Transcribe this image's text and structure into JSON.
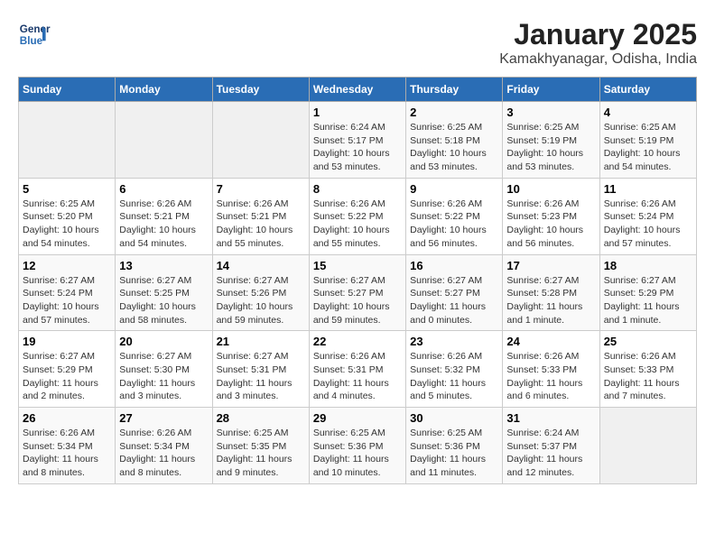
{
  "logo": {
    "text_line1": "General",
    "text_line2": "Blue"
  },
  "title": "January 2025",
  "subtitle": "Kamakhyanagar, Odisha, India",
  "days_of_week": [
    "Sunday",
    "Monday",
    "Tuesday",
    "Wednesday",
    "Thursday",
    "Friday",
    "Saturday"
  ],
  "weeks": [
    [
      {
        "day": "",
        "sunrise": "",
        "sunset": "",
        "daylight": ""
      },
      {
        "day": "",
        "sunrise": "",
        "sunset": "",
        "daylight": ""
      },
      {
        "day": "",
        "sunrise": "",
        "sunset": "",
        "daylight": ""
      },
      {
        "day": "1",
        "sunrise": "Sunrise: 6:24 AM",
        "sunset": "Sunset: 5:17 PM",
        "daylight": "Daylight: 10 hours and 53 minutes."
      },
      {
        "day": "2",
        "sunrise": "Sunrise: 6:25 AM",
        "sunset": "Sunset: 5:18 PM",
        "daylight": "Daylight: 10 hours and 53 minutes."
      },
      {
        "day": "3",
        "sunrise": "Sunrise: 6:25 AM",
        "sunset": "Sunset: 5:19 PM",
        "daylight": "Daylight: 10 hours and 53 minutes."
      },
      {
        "day": "4",
        "sunrise": "Sunrise: 6:25 AM",
        "sunset": "Sunset: 5:19 PM",
        "daylight": "Daylight: 10 hours and 54 minutes."
      }
    ],
    [
      {
        "day": "5",
        "sunrise": "Sunrise: 6:25 AM",
        "sunset": "Sunset: 5:20 PM",
        "daylight": "Daylight: 10 hours and 54 minutes."
      },
      {
        "day": "6",
        "sunrise": "Sunrise: 6:26 AM",
        "sunset": "Sunset: 5:21 PM",
        "daylight": "Daylight: 10 hours and 54 minutes."
      },
      {
        "day": "7",
        "sunrise": "Sunrise: 6:26 AM",
        "sunset": "Sunset: 5:21 PM",
        "daylight": "Daylight: 10 hours and 55 minutes."
      },
      {
        "day": "8",
        "sunrise": "Sunrise: 6:26 AM",
        "sunset": "Sunset: 5:22 PM",
        "daylight": "Daylight: 10 hours and 55 minutes."
      },
      {
        "day": "9",
        "sunrise": "Sunrise: 6:26 AM",
        "sunset": "Sunset: 5:22 PM",
        "daylight": "Daylight: 10 hours and 56 minutes."
      },
      {
        "day": "10",
        "sunrise": "Sunrise: 6:26 AM",
        "sunset": "Sunset: 5:23 PM",
        "daylight": "Daylight: 10 hours and 56 minutes."
      },
      {
        "day": "11",
        "sunrise": "Sunrise: 6:26 AM",
        "sunset": "Sunset: 5:24 PM",
        "daylight": "Daylight: 10 hours and 57 minutes."
      }
    ],
    [
      {
        "day": "12",
        "sunrise": "Sunrise: 6:27 AM",
        "sunset": "Sunset: 5:24 PM",
        "daylight": "Daylight: 10 hours and 57 minutes."
      },
      {
        "day": "13",
        "sunrise": "Sunrise: 6:27 AM",
        "sunset": "Sunset: 5:25 PM",
        "daylight": "Daylight: 10 hours and 58 minutes."
      },
      {
        "day": "14",
        "sunrise": "Sunrise: 6:27 AM",
        "sunset": "Sunset: 5:26 PM",
        "daylight": "Daylight: 10 hours and 59 minutes."
      },
      {
        "day": "15",
        "sunrise": "Sunrise: 6:27 AM",
        "sunset": "Sunset: 5:27 PM",
        "daylight": "Daylight: 10 hours and 59 minutes."
      },
      {
        "day": "16",
        "sunrise": "Sunrise: 6:27 AM",
        "sunset": "Sunset: 5:27 PM",
        "daylight": "Daylight: 11 hours and 0 minutes."
      },
      {
        "day": "17",
        "sunrise": "Sunrise: 6:27 AM",
        "sunset": "Sunset: 5:28 PM",
        "daylight": "Daylight: 11 hours and 1 minute."
      },
      {
        "day": "18",
        "sunrise": "Sunrise: 6:27 AM",
        "sunset": "Sunset: 5:29 PM",
        "daylight": "Daylight: 11 hours and 1 minute."
      }
    ],
    [
      {
        "day": "19",
        "sunrise": "Sunrise: 6:27 AM",
        "sunset": "Sunset: 5:29 PM",
        "daylight": "Daylight: 11 hours and 2 minutes."
      },
      {
        "day": "20",
        "sunrise": "Sunrise: 6:27 AM",
        "sunset": "Sunset: 5:30 PM",
        "daylight": "Daylight: 11 hours and 3 minutes."
      },
      {
        "day": "21",
        "sunrise": "Sunrise: 6:27 AM",
        "sunset": "Sunset: 5:31 PM",
        "daylight": "Daylight: 11 hours and 3 minutes."
      },
      {
        "day": "22",
        "sunrise": "Sunrise: 6:26 AM",
        "sunset": "Sunset: 5:31 PM",
        "daylight": "Daylight: 11 hours and 4 minutes."
      },
      {
        "day": "23",
        "sunrise": "Sunrise: 6:26 AM",
        "sunset": "Sunset: 5:32 PM",
        "daylight": "Daylight: 11 hours and 5 minutes."
      },
      {
        "day": "24",
        "sunrise": "Sunrise: 6:26 AM",
        "sunset": "Sunset: 5:33 PM",
        "daylight": "Daylight: 11 hours and 6 minutes."
      },
      {
        "day": "25",
        "sunrise": "Sunrise: 6:26 AM",
        "sunset": "Sunset: 5:33 PM",
        "daylight": "Daylight: 11 hours and 7 minutes."
      }
    ],
    [
      {
        "day": "26",
        "sunrise": "Sunrise: 6:26 AM",
        "sunset": "Sunset: 5:34 PM",
        "daylight": "Daylight: 11 hours and 8 minutes."
      },
      {
        "day": "27",
        "sunrise": "Sunrise: 6:26 AM",
        "sunset": "Sunset: 5:34 PM",
        "daylight": "Daylight: 11 hours and 8 minutes."
      },
      {
        "day": "28",
        "sunrise": "Sunrise: 6:25 AM",
        "sunset": "Sunset: 5:35 PM",
        "daylight": "Daylight: 11 hours and 9 minutes."
      },
      {
        "day": "29",
        "sunrise": "Sunrise: 6:25 AM",
        "sunset": "Sunset: 5:36 PM",
        "daylight": "Daylight: 11 hours and 10 minutes."
      },
      {
        "day": "30",
        "sunrise": "Sunrise: 6:25 AM",
        "sunset": "Sunset: 5:36 PM",
        "daylight": "Daylight: 11 hours and 11 minutes."
      },
      {
        "day": "31",
        "sunrise": "Sunrise: 6:24 AM",
        "sunset": "Sunset: 5:37 PM",
        "daylight": "Daylight: 11 hours and 12 minutes."
      },
      {
        "day": "",
        "sunrise": "",
        "sunset": "",
        "daylight": ""
      }
    ]
  ]
}
